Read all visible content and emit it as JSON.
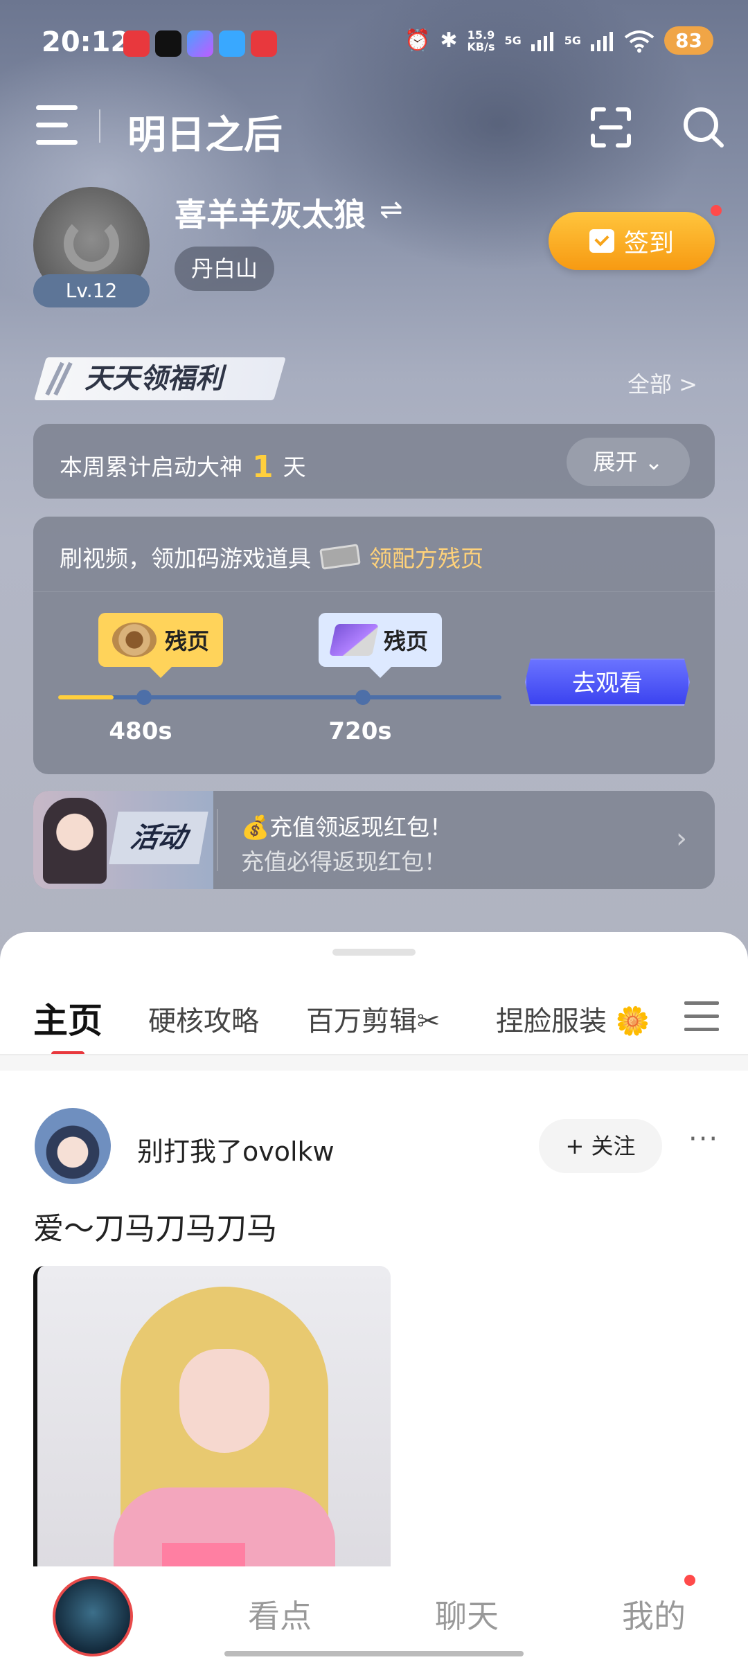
{
  "status_bar": {
    "time": "20:12",
    "net_speed_value": "15.9",
    "net_speed_unit": "KB/s",
    "signal_1": "5G",
    "signal_2": "5G",
    "battery": "83",
    "icons": [
      "alarm-icon",
      "bluetooth-icon",
      "signal-icon",
      "wifi-icon"
    ],
    "notification_apps": [
      "netease-app-icon",
      "tiktok-app-icon",
      "game-app-icon",
      "photo-app-icon",
      "netease-app-icon"
    ]
  },
  "header": {
    "title": "明日之后"
  },
  "profile": {
    "level": "Lv.12",
    "username": "喜羊羊灰太狼",
    "server": "丹白山",
    "signin_label": "签到"
  },
  "welfare": {
    "title": "天天领福利",
    "see_all": "全部 >"
  },
  "weekly": {
    "prefix": "本周累计启动大神",
    "count": "1",
    "suffix": "天",
    "expand_label": "展开 ⌄"
  },
  "video_task": {
    "text": "刷视频，领加码游戏道具",
    "link": "领配方残页",
    "rewards": [
      {
        "label": "残页",
        "time": "480s"
      },
      {
        "label": "残页",
        "time": "720s"
      }
    ],
    "progress_fraction": 0.125,
    "watch_label": "去观看"
  },
  "activity": {
    "badge": "活动",
    "title": "💰充值领返现红包！",
    "subtitle": "充值必得返现红包！"
  },
  "tabs": [
    {
      "label": "主页"
    },
    {
      "label": "硬核攻略"
    },
    {
      "label": "百万剪辑✂"
    },
    {
      "label": "捏脸服装 🌼"
    }
  ],
  "post": {
    "author": "别打我了ovolkw",
    "follow_label": "+ 关注",
    "more": "···",
    "text": "爱～刀马刀马刀马"
  },
  "bottom_nav": {
    "items": [
      "看点",
      "聊天",
      "我的"
    ]
  },
  "colors": {
    "accent_red": "#e8383d",
    "signin_orange": "#f79a12",
    "watch_blue": "#3b43f0",
    "highlight_yellow": "#ffcf3d"
  }
}
